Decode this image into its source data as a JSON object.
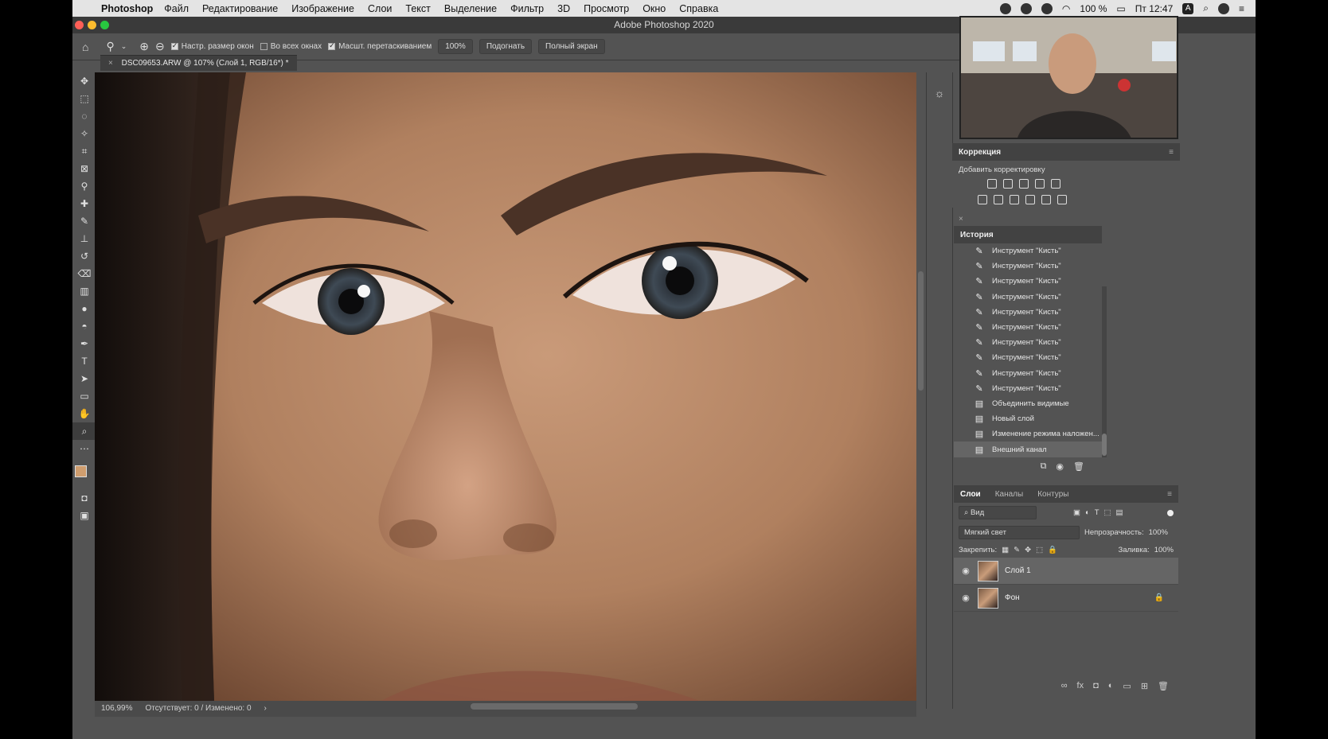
{
  "menubar": {
    "apple": "",
    "app_name": "Photoshop",
    "items": [
      "Файл",
      "Редактирование",
      "Изображение",
      "Слои",
      "Текст",
      "Выделение",
      "Фильтр",
      "3D",
      "Просмотр",
      "Окно",
      "Справка"
    ],
    "battery": "100 %",
    "clock": "Пт 12:47",
    "input_source": "A"
  },
  "window": {
    "title": "Adobe Photoshop 2020",
    "colors": {
      "close": "#ff5f57",
      "minimize": "#febc2e",
      "zoom": "#28c840"
    }
  },
  "options": {
    "resize_windows": "Настр. размер окон",
    "all_windows": "Во всех окнах",
    "scrubby_zoom": "Масшт. перетаскиванием",
    "zoom_value": "100%",
    "fit_button": "Подогнать",
    "fullscreen_button": "Полный экран"
  },
  "document": {
    "tab_title": "DSC09653.ARW @ 107% (Слой 1, RGB/16*) *",
    "zoom": "106,99%",
    "status": "Отсутствует: 0 / Изменено: 0"
  },
  "tools": [
    "move-tool",
    "marquee-tool",
    "lasso-tool",
    "quick-select-tool",
    "crop-tool",
    "frame-tool",
    "eyedropper-tool",
    "healing-tool",
    "brush-tool",
    "stamp-tool",
    "history-brush-tool",
    "eraser-tool",
    "gradient-tool",
    "blur-tool",
    "dodge-tool",
    "pen-tool",
    "type-tool",
    "path-select-tool",
    "shape-tool",
    "hand-tool",
    "zoom-tool",
    "more-tools"
  ],
  "adjustments": {
    "title": "Коррекция",
    "subtitle": "Добавить корректировку"
  },
  "history": {
    "title": "История",
    "items": [
      {
        "label": "Инструмент \"Кисть\"",
        "icon": "brush-icon"
      },
      {
        "label": "Инструмент \"Кисть\"",
        "icon": "brush-icon"
      },
      {
        "label": "Инструмент \"Кисть\"",
        "icon": "brush-icon"
      },
      {
        "label": "Инструмент \"Кисть\"",
        "icon": "brush-icon"
      },
      {
        "label": "Инструмент \"Кисть\"",
        "icon": "brush-icon"
      },
      {
        "label": "Инструмент \"Кисть\"",
        "icon": "brush-icon"
      },
      {
        "label": "Инструмент \"Кисть\"",
        "icon": "brush-icon"
      },
      {
        "label": "Инструмент \"Кисть\"",
        "icon": "brush-icon"
      },
      {
        "label": "Инструмент \"Кисть\"",
        "icon": "brush-icon"
      },
      {
        "label": "Инструмент \"Кисть\"",
        "icon": "brush-icon"
      },
      {
        "label": "Объединить видимые",
        "icon": "document-icon"
      },
      {
        "label": "Новый слой",
        "icon": "document-icon"
      },
      {
        "label": "Изменение режима наложен...",
        "icon": "document-icon"
      },
      {
        "label": "Внешний канал",
        "icon": "document-icon"
      }
    ]
  },
  "layers": {
    "tabs": [
      "Слои",
      "Каналы",
      "Контуры"
    ],
    "filter_label": "Вид",
    "blend_mode": "Мягкий свет",
    "opacity_label": "Непрозрачность:",
    "opacity_value": "100%",
    "lock_label": "Закрепить:",
    "fill_label": "Заливка:",
    "fill_value": "100%",
    "items": [
      {
        "name": "Слой 1"
      },
      {
        "name": "Фон"
      }
    ]
  }
}
